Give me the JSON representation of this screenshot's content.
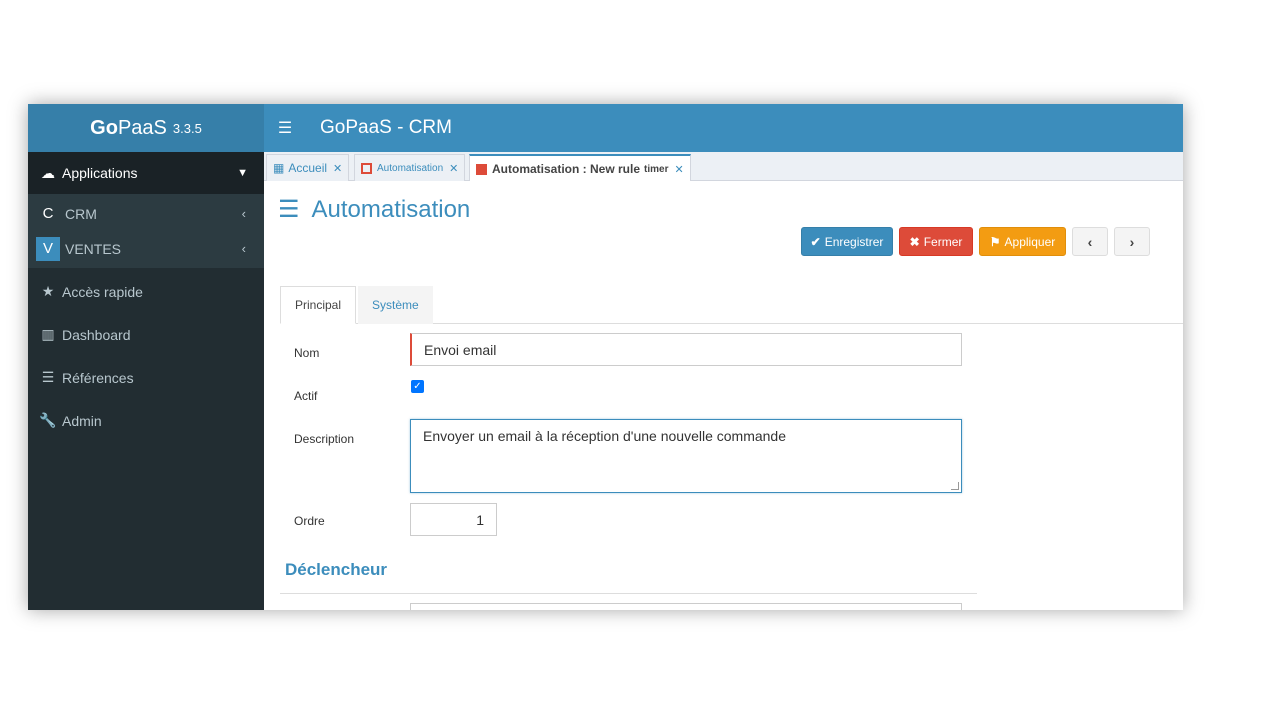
{
  "app": {
    "brand_bold": "Go",
    "brand_rest": "PaaS",
    "version": "3.3.5",
    "title": "GoPaaS - CRM"
  },
  "sidebar": {
    "applications_label": "Applications",
    "apps": [
      {
        "letter": "C",
        "label": "CRM",
        "color": "#2c3b41"
      },
      {
        "letter": "V",
        "label": "VENTES",
        "color": "#3c8dbc"
      }
    ],
    "items": [
      {
        "icon": "star-icon",
        "label": "Accès rapide"
      },
      {
        "icon": "bar-chart-icon",
        "label": "Dashboard"
      },
      {
        "icon": "list-icon",
        "label": "Références"
      },
      {
        "icon": "wrench-icon",
        "label": "Admin"
      }
    ]
  },
  "tabs": [
    {
      "icon": "grid-icon",
      "label": "Accueil"
    },
    {
      "icon": "square-icon",
      "label": "Automatisation"
    },
    {
      "icon": "square-icon",
      "label": "Automatisation : New rule",
      "suffix": "timer"
    }
  ],
  "page": {
    "title": "Automatisation",
    "buttons": {
      "save": "Enregistrer",
      "close": "Fermer",
      "apply": "Appliquer",
      "prev": "‹",
      "next": "›"
    },
    "form_tabs": [
      "Principal",
      "Système"
    ],
    "fields": {
      "name_label": "Nom",
      "name_value": "Envoi email",
      "active_label": "Actif",
      "active_checked": true,
      "description_label": "Description",
      "description_value": "Envoyer un email à la réception d'une nouvelle commande",
      "order_label": "Ordre",
      "order_value": "1"
    },
    "section_title": "Déclencheur"
  },
  "colors": {
    "primary": "#3c8dbc",
    "danger": "#dd4b39",
    "warning": "#f39c12",
    "sidebar": "#222d32"
  }
}
